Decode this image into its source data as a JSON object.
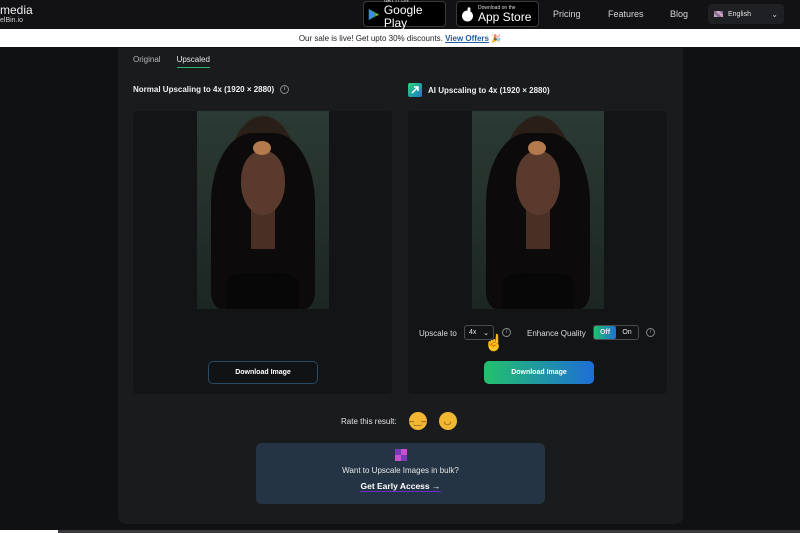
{
  "nav": {
    "brand_name": "media",
    "brand_sub": "elBin.io",
    "google_play": {
      "small": "GET IT ON",
      "big": "Google Play"
    },
    "app_store": {
      "small": "Download on the",
      "big": "App Store"
    },
    "links": [
      "Pricing",
      "Features",
      "Blog"
    ],
    "language": "English"
  },
  "banner": {
    "text": "Our sale is live! Get upto 30% discounts. ",
    "link": "View Offers",
    "emoji": "🎉"
  },
  "tabs": [
    {
      "label": "Original",
      "active": false
    },
    {
      "label": "Upscaled",
      "active": true
    }
  ],
  "left_panel": {
    "title": "Normal Upscaling to 4x (1920 × 2880)",
    "button": "Download Image"
  },
  "right_panel": {
    "title": "AI Upscaling to 4x (1920 × 2880)",
    "upscale_label": "Upscale to",
    "upscale_value": "4x",
    "enhance_label": "Enhance Quality",
    "toggle_off": "Off",
    "toggle_on": "On",
    "toggle_selected": "Off",
    "button": "Download Image"
  },
  "rating": {
    "label": "Rate this result:",
    "options": [
      "unamused-face",
      "grinning-face"
    ]
  },
  "bulk": {
    "question": "Want to Upscale Images in bulk?",
    "cta": "Get Early Access →"
  },
  "icons": {
    "info": "i",
    "chevron": "⌄",
    "cursor": "☝"
  }
}
